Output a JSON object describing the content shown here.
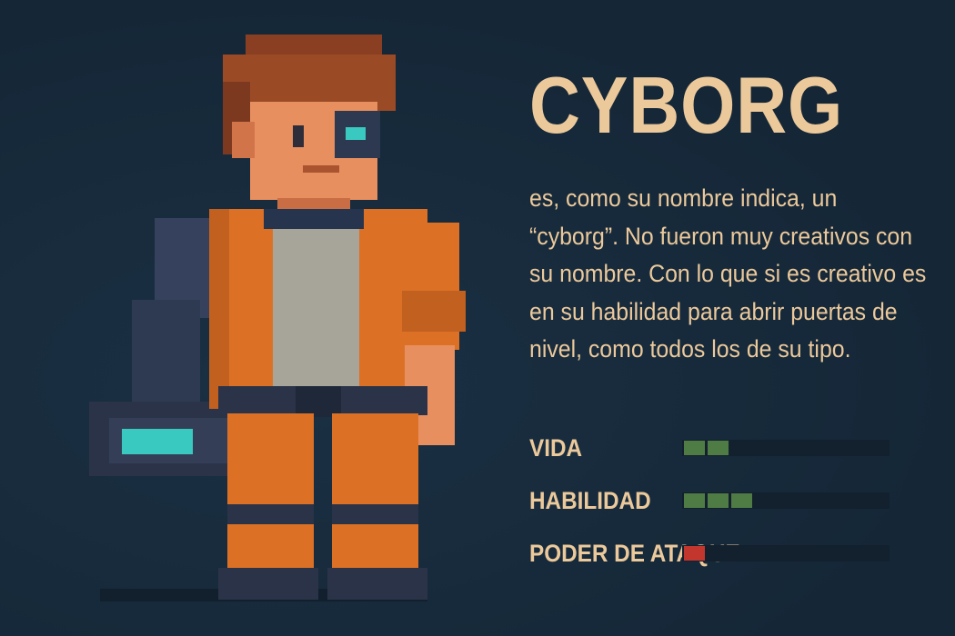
{
  "character": {
    "name": "CYBORG",
    "description": "es, como su nombre indica, un “cyborg”. No fueron muy creativos con su nombre. Con lo que si es creativo es en su habilidad para abrir puertas de nivel, como todos los de su tipo."
  },
  "stats": [
    {
      "label": "VIDA",
      "level": 2,
      "max": 9,
      "color": "#4f7b44"
    },
    {
      "label": "HABILIDAD",
      "level": 3,
      "max": 9,
      "color": "#4f7b44"
    },
    {
      "label": "PODER DE ATAQUE",
      "level": 1,
      "max": 9,
      "color": "#c2362e"
    }
  ],
  "colors": {
    "background": "#172a3c",
    "text": "#ecc99b",
    "bar_track": "#13202d"
  }
}
